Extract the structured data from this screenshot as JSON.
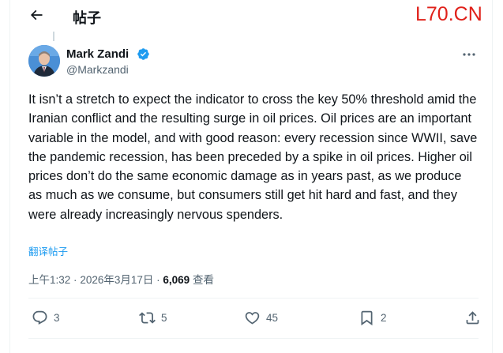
{
  "header": {
    "title": "帖子",
    "back_icon": "arrow-left-icon"
  },
  "watermark": {
    "text": "L70.CN",
    "color": "#e0211a"
  },
  "author": {
    "name": "Mark Zandi",
    "handle": "@Markzandi",
    "verified": true,
    "verified_color": "#1d9bf0"
  },
  "tweet": {
    "text": "It isn’t a stretch to expect the indicator to cross the key 50% threshold amid the Iranian conflict and the resulting surge in oil prices. Oil prices are an important variable in the model, and with good reason: every recession since WWII, save the pandemic recession, has been preceded by a spike in oil prices. Higher oil prices don’t do the same economic damage as in years past, as we produce as much as we consume, but consumers still get hit hard and fast, and they were already increasingly nervous spenders.",
    "translate_label": "翻译帖子"
  },
  "meta": {
    "time": "上午1:32",
    "separator": "·",
    "date": "2026年3月17日",
    "views": "6,069",
    "views_label": "查看"
  },
  "actions": {
    "replies": "3",
    "reposts": "5",
    "likes": "45",
    "bookmarks": "2"
  },
  "colors": {
    "accent": "#1d9bf0",
    "muted": "#536471",
    "text": "#0f1419"
  }
}
